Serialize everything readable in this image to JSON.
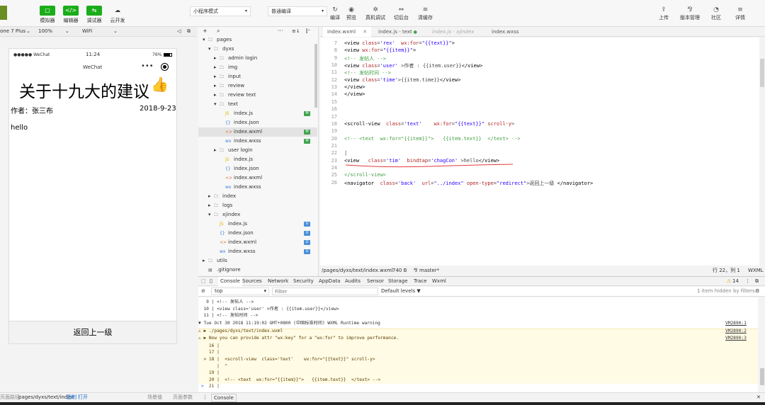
{
  "toolbar": {
    "left": [
      {
        "icon": "phone-icon",
        "label": "模拟器"
      },
      {
        "icon": "code-icon",
        "label": "编辑器"
      },
      {
        "icon": "debug-icon",
        "label": "调试器"
      },
      {
        "icon": "cloud-icon",
        "label": "云开发"
      }
    ],
    "mode_select": "小程序模式",
    "compile_select": "普通编译",
    "mid": [
      {
        "icon": "refresh-icon",
        "label": "编译"
      },
      {
        "icon": "eye-icon",
        "label": "预览"
      },
      {
        "icon": "bug-icon",
        "label": "真机调试"
      },
      {
        "icon": "switch-icon",
        "label": "切后台"
      },
      {
        "icon": "layers-icon",
        "label": "清缓存"
      }
    ],
    "right": [
      {
        "icon": "upload-icon",
        "label": "上传"
      },
      {
        "icon": "branch-icon",
        "label": "版本管理"
      },
      {
        "icon": "community-icon",
        "label": "社区"
      },
      {
        "icon": "menu-icon",
        "label": "详情"
      }
    ]
  },
  "sim": {
    "device": "one 7 Plus",
    "zoom": "100%",
    "network": "WiFi",
    "phone": {
      "carrier": "●●●●● WeChat",
      "time": "11:24",
      "battery": "76%",
      "nav_title": "WeChat",
      "heading": "关于十九大的建议",
      "author": "作者：张三布",
      "date": "2018-9-23",
      "body": "hello",
      "back_button": "返回上一级"
    }
  },
  "explorer": {
    "rows": [
      {
        "indent": 0,
        "name": "pages",
        "icon": "folder-icon",
        "arrow": "▾"
      },
      {
        "indent": 1,
        "name": "dyxs",
        "icon": "folder-icon",
        "arrow": "▾"
      },
      {
        "indent": 2,
        "name": "admin login",
        "icon": "folder-icon",
        "arrow": "▸"
      },
      {
        "indent": 2,
        "name": "img",
        "icon": "folder-icon",
        "arrow": "▸"
      },
      {
        "indent": 2,
        "name": "input",
        "icon": "folder-icon",
        "arrow": "▸"
      },
      {
        "indent": 2,
        "name": "review",
        "icon": "folder-icon",
        "arrow": "▸"
      },
      {
        "indent": 2,
        "name": "review text",
        "icon": "folder-icon",
        "arrow": "▸"
      },
      {
        "indent": 2,
        "name": "text",
        "icon": "folder-icon",
        "arrow": "▾"
      },
      {
        "indent": 3,
        "name": "index.js",
        "icon": "js-file-icon",
        "badge": "M"
      },
      {
        "indent": 3,
        "name": "index.json",
        "icon": "json-file-icon"
      },
      {
        "indent": 3,
        "name": "index.wxml",
        "icon": "wxml-file-icon",
        "badge": "M",
        "selected": true
      },
      {
        "indent": 3,
        "name": "index.wxss",
        "icon": "wxss-file-icon",
        "badge": "M"
      },
      {
        "indent": 2,
        "name": "user login",
        "icon": "folder-icon",
        "arrow": "▸"
      },
      {
        "indent": 3,
        "name": "index.js",
        "icon": "js-file-icon"
      },
      {
        "indent": 3,
        "name": "index.json",
        "icon": "json-file-icon"
      },
      {
        "indent": 3,
        "name": "index.wxml",
        "icon": "wxml-file-icon"
      },
      {
        "indent": 3,
        "name": "index.wxss",
        "icon": "wxss-file-icon"
      },
      {
        "indent": 1,
        "name": "index",
        "icon": "folder-icon",
        "arrow": "▸"
      },
      {
        "indent": 1,
        "name": "logs",
        "icon": "folder-icon",
        "arrow": "▸"
      },
      {
        "indent": 1,
        "name": "xjindex",
        "icon": "folder-icon",
        "arrow": "▾"
      },
      {
        "indent": 2,
        "name": "index.js",
        "icon": "js-file-icon",
        "badge": "U"
      },
      {
        "indent": 2,
        "name": "index.json",
        "icon": "json-file-icon",
        "badge": "U"
      },
      {
        "indent": 2,
        "name": "index.wxml",
        "icon": "wxml-file-icon",
        "badge": "U"
      },
      {
        "indent": 2,
        "name": "index.wxss",
        "icon": "wxss-file-icon",
        "badge": "U"
      },
      {
        "indent": 0,
        "name": "utils",
        "icon": "folder-icon",
        "arrow": "▸"
      },
      {
        "indent": 0,
        "name": ".gitignore",
        "icon": "file-icon"
      }
    ]
  },
  "editor": {
    "tabs": [
      {
        "label": "index.wxml",
        "active": true
      },
      {
        "label": "index.js - text"
      },
      {
        "label": "index.js - xjindex",
        "italic": true
      },
      {
        "label": "index.wxss"
      }
    ],
    "lines": [
      {
        "n": "7",
        "html": "<span class=\"t\">&lt;view</span> <span class=\"k\">class</span>=<span class=\"s\">'rex'</span>  <span class=\"k\">wx:for</span>=<span class=\"s\">\"{{text}}\"</span><span class=\"t\">&gt;</span>"
      },
      {
        "n": "8",
        "html": "<span class=\"t\">&lt;view</span> <span class=\"k\">wx:for</span>=<span class=\"s\">\"{{item}}\"</span><span class=\"t\">&gt;</span>"
      },
      {
        "n": "9",
        "html": "<span class=\"c\">&lt;!-- 发帖人 --&gt;</span>"
      },
      {
        "n": "10",
        "html": "<span class=\"t\">&lt;view</span> <span class=\"k\">class</span>=<span class=\"s\">'user'</span> &gt;作者 : {{item.user}}<span class=\"t\">&lt;/view&gt;</span>"
      },
      {
        "n": "11",
        "html": "<span class=\"c\">&lt;!-- 发帖时间 --&gt;</span>"
      },
      {
        "n": "12",
        "html": "<span class=\"t\">&lt;view</span> <span class=\"k\">class</span>=<span class=\"s\">'time'</span>&gt;{{item.time}}<span class=\"t\">&lt;/view&gt;</span>"
      },
      {
        "n": "13",
        "html": "<span class=\"t\">&lt;/view&gt;</span>"
      },
      {
        "n": "14",
        "html": "<span class=\"t\">&lt;/view&gt;</span>"
      },
      {
        "n": "15",
        "html": ""
      },
      {
        "n": "16",
        "html": ""
      },
      {
        "n": "17",
        "html": ""
      },
      {
        "n": "18",
        "html": "<span class=\"t\">&lt;scroll-view</span>  <span class=\"k\">class</span>=<span class=\"s\">'text'</span>    <span class=\"k\">wx:for</span>=<span class=\"s\">\"{{text}}\"</span> <span class=\"k\">scroll-y</span>&gt;"
      },
      {
        "n": "19",
        "html": ""
      },
      {
        "n": "20",
        "html": "<span class=\"c\">&lt;!-- &lt;text  wx:for=\"{{item}}\"&gt;   {{item.text}}  &lt;/text&gt; --&gt;</span>"
      },
      {
        "n": "21",
        "html": ""
      },
      {
        "n": "22",
        "html": "|"
      },
      {
        "n": "23",
        "html": "<span class=\"t\">&lt;view</span>   <span class=\"k\">class</span>=<span class=\"s\">'tim'</span>  <span class=\"k\">bindtap</span>=<span class=\"s\">'chagCon'</span> &gt;hello<span class=\"t\">&lt;/view&gt;</span>"
      },
      {
        "n": "24",
        "html": ""
      },
      {
        "n": "25",
        "html": "<span class=\"c\">&lt;/scroll-view&gt;</span>"
      },
      {
        "n": "26",
        "html": "<span class=\"t\">&lt;navigator</span>  <span class=\"k\">class</span>=<span class=\"s\">'back'</span>  <span class=\"k\">url</span>=<span class=\"s\">\"../index\"</span> <span class=\"k\">open-type</span>=<span class=\"s\">\"redirect\"</span>&gt;返回上一级 <span class=\"t\">&lt;/navigator&gt;</span>"
      }
    ],
    "status_path": "/pages/dyxs/text/index.wxml",
    "status_size": "740 B",
    "status_branch": "master*",
    "status_pos": "行 22，列 1",
    "status_lang": "WXML"
  },
  "devtools": {
    "tabs": [
      "Console",
      "Sources",
      "Network",
      "Security",
      "AppData",
      "Audits",
      "Sensor",
      "Storage",
      "Trace",
      "Wxml"
    ],
    "warn_count": "14",
    "context": "top",
    "filter_placeholder": "Filter",
    "levels": "Default levels ▼",
    "hidden": "1 item hidden by filters",
    "console_lines": [
      {
        "text": "   9 | <!-- 发帖人 -->",
        "link": ""
      },
      {
        "text": "  10 | <view class='user' >作者 : {{item.user}}</view>",
        "link": ""
      },
      {
        "text": "  11 | <!-- 发帖时间 -->",
        "link": ""
      },
      {
        "text": "▼ Tue Oct 30 2018 11:19:02 GMT+0800 (中国标准时间) WXML Runtime warning",
        "link": "VM2890:1"
      },
      {
        "text": "⚠ ▶ ./pages/dyxs/text/index.wxml",
        "link": "VM2890:2",
        "warn": true
      },
      {
        "text": "⚠ ▶ Now you can provide attr \"wx:key\" for a \"wx:for\" to improve performance.",
        "link": "VM2890:3",
        "warn": true
      },
      {
        "text": "    16 |",
        "link": "",
        "warn": true
      },
      {
        "text": "    17 |",
        "link": "",
        "warn": true
      },
      {
        "text": "  > 18 |  <scroll-view  class='text'    wx:for=\"{{text}}\" scroll-y>",
        "link": "",
        "warn": true
      },
      {
        "text": "       |  ^",
        "link": "",
        "warn": true
      },
      {
        "text": "    19 |",
        "link": "",
        "warn": true
      },
      {
        "text": "    20 |  <!-- <text  wx:for=\"{{item}}\">   {{item.text}}  </text> -->",
        "link": "",
        "warn": true
      },
      {
        "text": "    21 |",
        "link": "",
        "warn": true
      }
    ],
    "prompt": ">"
  },
  "bottom": {
    "path_label": "页面路径",
    "path": "pages/dyxs/text/index",
    "copy": "复制",
    "open": "打开",
    "scene": "场景值",
    "params": "页面参数",
    "console_tab": "Console"
  }
}
